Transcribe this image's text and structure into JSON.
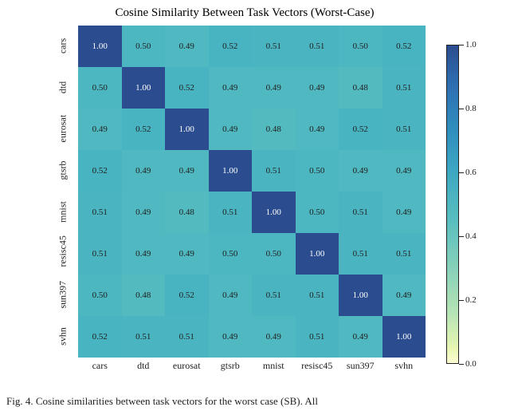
{
  "chart_data": {
    "type": "heatmap",
    "title": "Cosine Similarity Between Task Vectors (Worst-Case)",
    "xlabel": "",
    "ylabel": "",
    "categories": [
      "cars",
      "dtd",
      "eurosat",
      "gtsrb",
      "mnist",
      "resisc45",
      "sun397",
      "svhn"
    ],
    "matrix": [
      [
        1.0,
        0.5,
        0.49,
        0.52,
        0.51,
        0.51,
        0.5,
        0.52
      ],
      [
        0.5,
        1.0,
        0.52,
        0.49,
        0.49,
        0.49,
        0.48,
        0.51
      ],
      [
        0.49,
        0.52,
        1.0,
        0.49,
        0.48,
        0.49,
        0.52,
        0.51
      ],
      [
        0.52,
        0.49,
        0.49,
        1.0,
        0.51,
        0.5,
        0.49,
        0.49
      ],
      [
        0.51,
        0.49,
        0.48,
        0.51,
        1.0,
        0.5,
        0.51,
        0.49
      ],
      [
        0.51,
        0.49,
        0.49,
        0.5,
        0.5,
        1.0,
        0.51,
        0.51
      ],
      [
        0.5,
        0.48,
        0.52,
        0.49,
        0.51,
        0.51,
        1.0,
        0.49
      ],
      [
        0.52,
        0.51,
        0.51,
        0.49,
        0.49,
        0.51,
        0.49,
        1.0
      ]
    ],
    "vmin": 0.0,
    "vmax": 1.0,
    "colorbar_ticks": [
      0.0,
      0.2,
      0.4,
      0.6,
      0.8,
      1.0
    ]
  },
  "caption": "Fig. 4. Cosine similarities between task vectors for the worst case (SB). All"
}
